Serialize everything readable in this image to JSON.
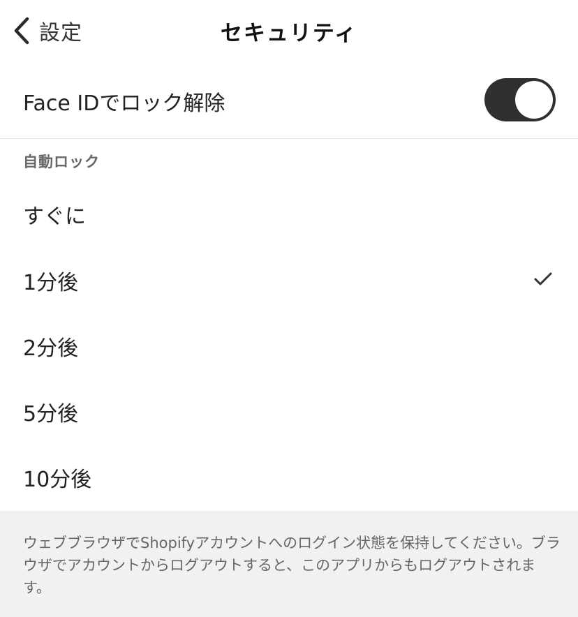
{
  "nav": {
    "back_label": "設定",
    "title": "セキュリティ"
  },
  "face_id": {
    "label": "Face IDでロック解除",
    "enabled": true
  },
  "auto_lock": {
    "header": "自動ロック",
    "options": [
      {
        "label": "すぐに",
        "selected": false
      },
      {
        "label": "1分後",
        "selected": true
      },
      {
        "label": "2分後",
        "selected": false
      },
      {
        "label": "5分後",
        "selected": false
      },
      {
        "label": "10分後",
        "selected": false
      }
    ]
  },
  "footer": {
    "note": "ウェブブラウザでShopifyアカウントへのログイン状態を保持してください。ブラウザでアカウントからログアウトすると、このアプリからもログアウトされます。"
  },
  "colors": {
    "toggle_on": "#303030",
    "footer_bg": "#f1f1f1",
    "text": "#222222",
    "secondary_text": "#666666"
  },
  "icons": {
    "back": "chevron-left-icon",
    "selected": "checkmark-icon"
  }
}
